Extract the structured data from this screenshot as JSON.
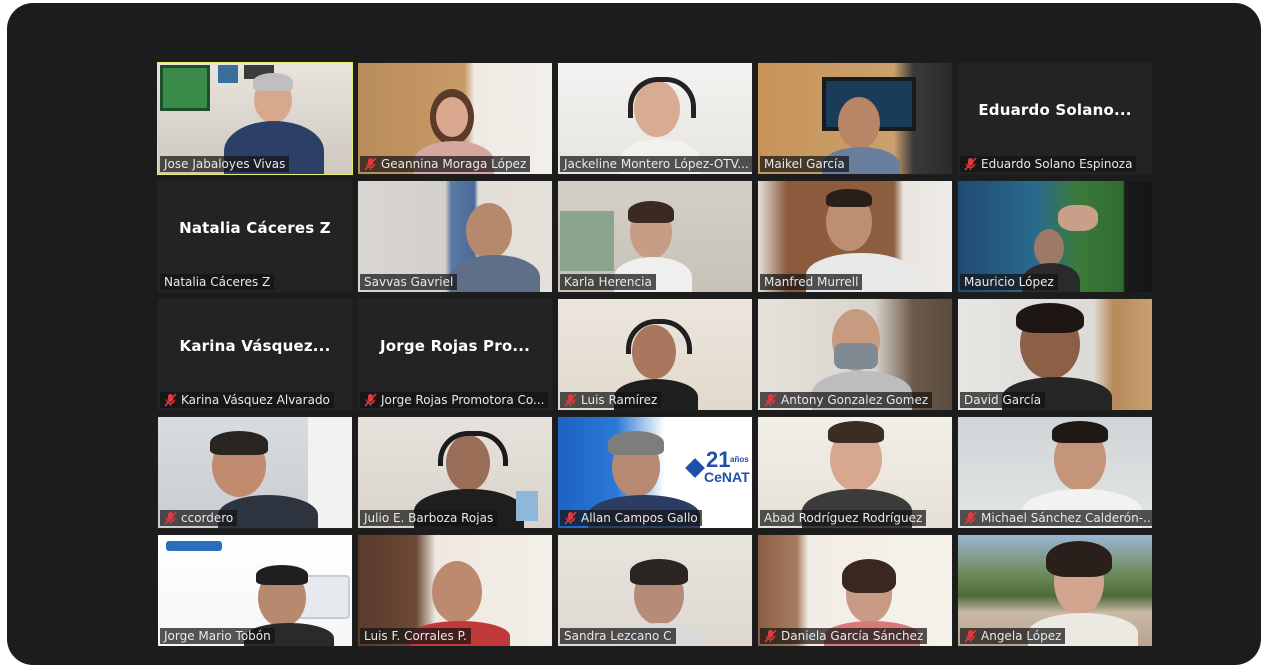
{
  "meeting": {
    "participants": [
      {
        "name": "Jose Jabaloyes Vivas",
        "muted": false,
        "video": true,
        "speaking": true
      },
      {
        "name": "Geannina Moraga López",
        "muted": true,
        "video": true
      },
      {
        "name": "Jackeline Montero López-OTV...",
        "muted": false,
        "video": true
      },
      {
        "name": "Maikel García",
        "muted": false,
        "video": true
      },
      {
        "name": "Eduardo Solano Espinoza",
        "avatar_text": "Eduardo  Solano...",
        "muted": true,
        "video": false
      },
      {
        "name": "Natalia Cáceres Z",
        "avatar_text": "Natalia Cáceres Z",
        "muted": false,
        "video": false
      },
      {
        "name": "Savvas Gavriel",
        "muted": false,
        "video": true
      },
      {
        "name": "Karla Herencia",
        "muted": false,
        "video": true
      },
      {
        "name": "Manfred Murrell",
        "muted": false,
        "video": true
      },
      {
        "name": "Mauricio López",
        "muted": false,
        "video": true
      },
      {
        "name": "Karina Vásquez Alvarado",
        "avatar_text": "Karina  Vásquez...",
        "muted": true,
        "video": false
      },
      {
        "name": "Jorge Rojas Promotora Co...",
        "avatar_text": "Jorge  Rojas  Pro...",
        "muted": true,
        "video": false
      },
      {
        "name": "Luis Ramírez",
        "muted": true,
        "video": true
      },
      {
        "name": "Antony Gonzalez Gomez",
        "muted": true,
        "video": true
      },
      {
        "name": "David García",
        "muted": false,
        "video": true
      },
      {
        "name": "ccordero",
        "muted": true,
        "video": true
      },
      {
        "name": "Julio E. Barboza Rojas",
        "muted": false,
        "video": true
      },
      {
        "name": "Allan Campos Gallo",
        "muted": true,
        "video": true,
        "banner_big": "21",
        "banner_small": "años",
        "banner_brand": "CeNAT"
      },
      {
        "name": "Abad Rodríguez Rodríguez",
        "muted": false,
        "video": true
      },
      {
        "name": "Michael Sánchez Calderón-...",
        "muted": true,
        "video": true
      },
      {
        "name": "Jorge Mario Tobón",
        "muted": false,
        "video": true
      },
      {
        "name": "Luis F. Corrales P.",
        "muted": false,
        "video": true
      },
      {
        "name": "Sandra Lezcano C",
        "muted": false,
        "video": true
      },
      {
        "name": "Daniela García Sánchez",
        "muted": true,
        "video": true
      },
      {
        "name": "Angela López",
        "muted": true,
        "video": true
      }
    ],
    "colors": {
      "frame": "#1c1c1c",
      "tile_bg": "#232323",
      "speaker_outline": "#e8ec6a",
      "mute_red": "#e0393e"
    }
  }
}
